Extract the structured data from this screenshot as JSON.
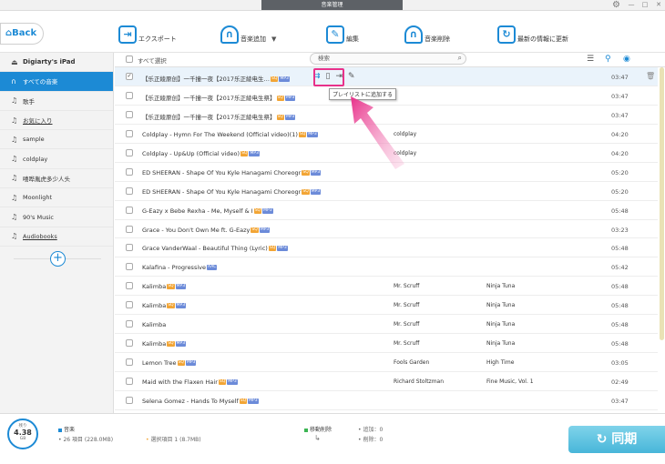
{
  "window": {
    "title": "音楽管理"
  },
  "toolbar": {
    "back": "Back",
    "export": "エクスポート",
    "add_music": "音楽追加",
    "edit": "編集",
    "delete": "音楽削除",
    "refresh": "最新の情報に更新"
  },
  "sidebar": {
    "device": "Digiarty's iPad",
    "items": [
      {
        "label": "すべての音楽"
      },
      {
        "label": "歌手"
      },
      {
        "label": "お気に入り"
      },
      {
        "label": "sample"
      },
      {
        "label": "coldplay"
      },
      {
        "label": "嘻哗胤虎多少人头"
      },
      {
        "label": "Moonlight"
      },
      {
        "label": "90's Music"
      },
      {
        "label": "Audiobooks"
      }
    ],
    "add_symbol": "+"
  },
  "list": {
    "select_all": "すべて選択",
    "search_placeholder": "検索",
    "tooltip": "プレイリストに追加する",
    "rows": [
      {
        "title": "【乐正綾原创】一千撞一夜【2017乐正綾电生…",
        "q": "SQ",
        "fmt": "MP3",
        "artist": "",
        "album": "",
        "dur": "03:47"
      },
      {
        "title": "【乐正綾原创】一千撞一夜【2017乐正綾电生祭】",
        "q": "SQ",
        "fmt": "MP3",
        "artist": "",
        "album": "",
        "dur": "03:47"
      },
      {
        "title": "【乐正綾原创】一千撞一夜【2017乐正綾电生祭】",
        "q": "SQ",
        "fmt": "MP3",
        "artist": "",
        "album": "",
        "dur": "03:47"
      },
      {
        "title": "Coldplay - Hymn For The Weekend (Official video)(1)",
        "q": "SQ",
        "fmt": "MP3",
        "artist": "coldplay",
        "album": "",
        "dur": "04:20"
      },
      {
        "title": "Coldplay - Up&Up (Official video)",
        "q": "SQ",
        "fmt": "MP3",
        "artist": "coldplay",
        "album": "",
        "dur": "04:20"
      },
      {
        "title": "ED SHEERAN - Shape Of You   Kyle Hanagami Choreogr",
        "q": "SQ",
        "fmt": "MP3",
        "artist": "",
        "album": "",
        "dur": "05:20"
      },
      {
        "title": "ED SHEERAN - Shape Of You   Kyle Hanagami Choreogr",
        "q": "SQ",
        "fmt": "MP3",
        "artist": "",
        "album": "",
        "dur": "05:20"
      },
      {
        "title": "G-Eazy x Bebe Rexha - Me, Myself & I",
        "q": "SQ",
        "fmt": "MP3",
        "artist": "",
        "album": "",
        "dur": "05:48"
      },
      {
        "title": "Grace - You Don't Own Me ft. G-Eazy",
        "q": "SQ",
        "fmt": "MP3",
        "artist": "",
        "album": "",
        "dur": "03:23"
      },
      {
        "title": "Grace VanderWaal - Beautiful Thing (Lyric)",
        "q": "SQ",
        "fmt": "MP3",
        "artist": "",
        "album": "",
        "dur": "05:48"
      },
      {
        "title": "Kalafina - Progressive",
        "q": "",
        "fmt": "AAC",
        "artist": "",
        "album": "",
        "dur": "05:42"
      },
      {
        "title": "Kalimba",
        "q": "SQ",
        "fmt": "MP3",
        "artist": "Mr. Scruff",
        "album": "Ninja Tuna",
        "dur": "05:48"
      },
      {
        "title": "Kalimba",
        "q": "SQ",
        "fmt": "MP3",
        "artist": "Mr. Scruff",
        "album": "Ninja Tuna",
        "dur": "05:48"
      },
      {
        "title": "Kalimba",
        "q": "",
        "fmt": "",
        "artist": "Mr. Scruff",
        "album": "Ninja Tuna",
        "dur": "05:48"
      },
      {
        "title": "Kalimba",
        "q": "SQ",
        "fmt": "MP3",
        "artist": "Mr. Scruff",
        "album": "Ninja Tuna",
        "dur": "05:48"
      },
      {
        "title": "Lemon Tree",
        "q": "SQ",
        "fmt": "MP3",
        "artist": "Fools Garden",
        "album": "High Time",
        "dur": "03:05"
      },
      {
        "title": "Maid with the Flaxen Hair",
        "q": "SQ",
        "fmt": "MP3",
        "artist": "Richard Stoltzman",
        "album": "Fine Music, Vol. 1",
        "dur": "02:49"
      },
      {
        "title": "Selena Gomez - Hands To Myself",
        "q": "SQ",
        "fmt": "MP3",
        "artist": "",
        "album": "",
        "dur": "03:47"
      }
    ]
  },
  "footer": {
    "storage_label": "残り",
    "storage_value": "4.38",
    "storage_unit": "GB",
    "music_label": "音楽",
    "items_text": "26 項目 (228.0MB)",
    "selected_text": "選択項目 1 (8.7MB)",
    "pending_label": "移動削除",
    "add_text": "追加：0",
    "del_text": "削除：0",
    "sync": "同期"
  },
  "colors": {
    "accent": "#1c8ad5",
    "sq": "#f2a535",
    "format": "#6c8bd9",
    "highlight": "#e8318a"
  }
}
